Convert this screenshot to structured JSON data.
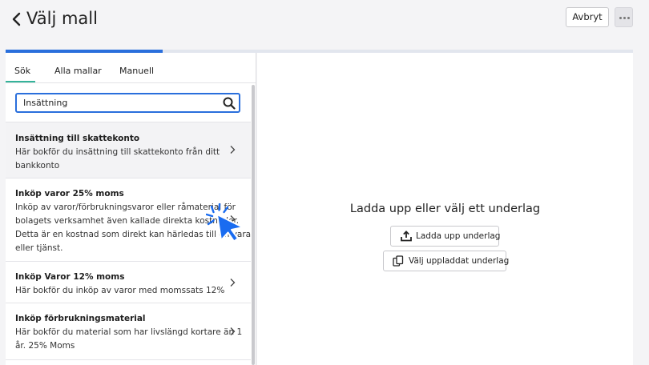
{
  "header": {
    "title": "Välj mall",
    "cancel_label": "Avbryt"
  },
  "progress": {
    "fraction": 0.25
  },
  "tabs": [
    {
      "label": "Sök",
      "active": true
    },
    {
      "label": "Alla mallar",
      "active": false
    },
    {
      "label": "Manuell",
      "active": false
    }
  ],
  "search": {
    "value": "Insättning"
  },
  "templates": [
    {
      "title": "Insättning till skattekonto",
      "desc": [
        "Här bokför du insättning till skattekonto från ditt",
        "bankkonto"
      ]
    },
    {
      "title": "Inköp varor 25% moms",
      "desc": [
        "Inköp av varor/förbrukningsvaror eller råmaterial för",
        "bolagets verksamhet även kallade direkta kostnader.",
        "Detta är en kostnad som direkt kan härledas till en vara",
        "eller tjänst."
      ]
    },
    {
      "title": "Inköp Varor 12% moms",
      "desc": [
        "Här bokför du inköp av varor med momssats 12%"
      ]
    },
    {
      "title": "Inköp förbrukningsmaterial",
      "desc": [
        "Här bokför du material som har livslängd kortare än 1",
        "år. 25% Moms"
      ]
    }
  ],
  "upload": {
    "heading": "Ladda upp eller välj ett underlag",
    "upload_label": "Ladda upp underlag",
    "choose_label": "Välj uppladdat underlag"
  },
  "colors": {
    "accent": "#2a6fdc",
    "tab_indicator": "#34b39a",
    "cursor": "#1a6cf0"
  }
}
